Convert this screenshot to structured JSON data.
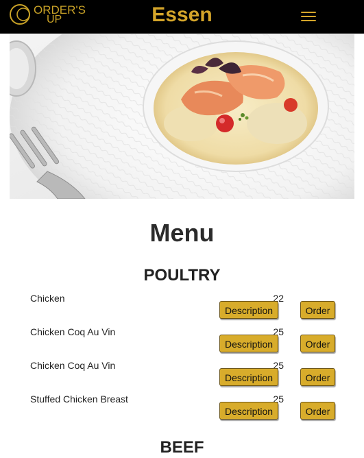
{
  "navbar": {
    "logo": {
      "line1": "ORDER'S",
      "line2": "UP"
    },
    "brand": "Essen",
    "toggle_icon": "hamburger-menu-icon",
    "accent_color": "#d4a52a"
  },
  "hero": {
    "image_alt": ""
  },
  "page": {
    "title": "Menu"
  },
  "sections": [
    {
      "title": "POULTRY",
      "items": [
        {
          "name": "Chicken",
          "price": "22",
          "description_label": "Description",
          "order_label": "Order"
        },
        {
          "name": "Chicken Coq Au Vin",
          "price": "25",
          "description_label": "Description",
          "order_label": "Order"
        },
        {
          "name": "Chicken Coq Au Vin",
          "price": "25",
          "description_label": "Description",
          "order_label": "Order"
        },
        {
          "name": "Stuffed Chicken Breast",
          "price": "25",
          "description_label": "Description",
          "order_label": "Order"
        }
      ]
    },
    {
      "title": "BEEF"
    }
  ]
}
